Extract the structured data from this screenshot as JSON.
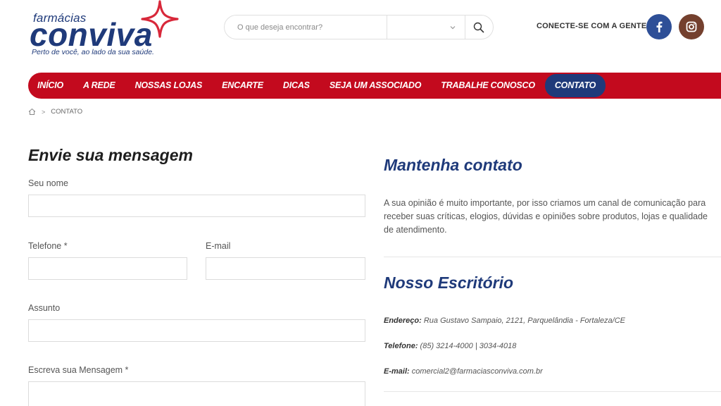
{
  "logo": {
    "top_word": "farmácias",
    "brand": "conviva",
    "tagline": "Perto de você, ao lado da sua saúde."
  },
  "search": {
    "placeholder": "O que deseja encontrar?",
    "select_value": "",
    "button_icon": "search-icon"
  },
  "social": {
    "label": "CONECTE-SE COM A GENTE:",
    "items": [
      {
        "name": "facebook",
        "icon": "facebook-icon",
        "color": "#2e4f97"
      },
      {
        "name": "instagram",
        "icon": "instagram-icon",
        "color": "#74402e"
      }
    ]
  },
  "nav": {
    "items": [
      {
        "label": "INÍCIO"
      },
      {
        "label": "A REDE"
      },
      {
        "label": "NOSSAS LOJAS"
      },
      {
        "label": "ENCARTE"
      },
      {
        "label": "DICAS"
      },
      {
        "label": "SEJA UM ASSOCIADO"
      },
      {
        "label": "TRABALHE CONOSCO"
      },
      {
        "label": "CONTATO",
        "active": true
      }
    ],
    "color": "#c30a1e",
    "active_color": "#1f3a7a"
  },
  "breadcrumb": {
    "home_icon": "home-icon",
    "separator": ">",
    "current": "CONTATO"
  },
  "form": {
    "title_strong": "Envie",
    "title_rest": " sua mensagem",
    "name_label": "Seu nome",
    "phone_label": "Telefone *",
    "email_label": "E-mail",
    "subject_label": "Assunto",
    "message_label": "Escreva sua Mensagem *"
  },
  "contact": {
    "title_light": "Mantenha ",
    "title_strong": "contato",
    "text": "A sua opinião é muito importante, por isso criamos um canal de comunicação para receber suas críticas, elogios, dúvidas e opiniões sobre produtos, lojas e qualidade de atendimento."
  },
  "office": {
    "title_light": "Nosso ",
    "title_strong": "Escritório",
    "address_key": "Endereço:",
    "address_value": " Rua Gustavo Sampaio, 2121, Parquelândia - Fortaleza/CE",
    "phone_key": "Telefone:",
    "phone_value": " (85) 3214-4000 | 3034-4018",
    "email_key": "E-mail:",
    "email_value": " comercial2@farmaciasconviva.com.br"
  },
  "colors": {
    "brand_blue": "#1f3a7a",
    "brand_red": "#c30a1e"
  }
}
